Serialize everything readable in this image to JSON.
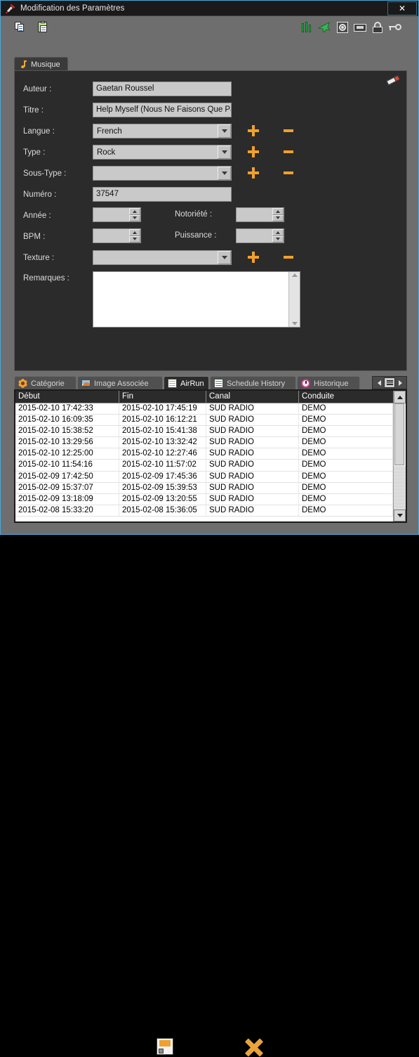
{
  "window": {
    "title": "Modification des Paramètres",
    "title_icon": "wrench-screwdriver-icon",
    "close_label": "✕",
    "accent_orange": "#f0a02e",
    "bg": "#6e6e6e",
    "panel_bg": "#2b2b2b"
  },
  "toolbar": {
    "items": [
      {
        "name": "copy-icon",
        "title": "Copier"
      },
      {
        "name": "paste-icon",
        "title": "Coller"
      },
      {
        "name": "bars-icon",
        "title": "Statistiques"
      },
      {
        "name": "plane-icon",
        "title": "Diffusion"
      },
      {
        "name": "target-icon",
        "title": "Cible"
      },
      {
        "name": "cassette-icon",
        "title": "Cassette"
      },
      {
        "name": "lock-icon",
        "title": "Verrouiller"
      },
      {
        "name": "key-icon",
        "title": "Clé"
      }
    ]
  },
  "top_tab": {
    "label": "Musique",
    "icon": "music-note-icon"
  },
  "form": {
    "eraser_icon": "eraser-icon",
    "fields": {
      "auteur": {
        "label": "Auteur :",
        "value": "Gaetan Roussel",
        "placeholder": ""
      },
      "titre": {
        "label": "Titre :",
        "value": "Help Myself (Nous Ne Faisons Que Pas",
        "placeholder": ""
      },
      "langue": {
        "label": "Langue :",
        "value": "French",
        "placeholder": ""
      },
      "type": {
        "label": "Type :",
        "value": "Rock",
        "placeholder": ""
      },
      "sous_type": {
        "label": "Sous-Type :",
        "value": "",
        "placeholder": ""
      },
      "numero": {
        "label": "Numéro :",
        "value": "37547",
        "placeholder": ""
      },
      "annee": {
        "label": "Année :",
        "value": "",
        "placeholder": ""
      },
      "notoriete": {
        "label": "Notoriété :",
        "value": "",
        "placeholder": ""
      },
      "bpm": {
        "label": "BPM :",
        "value": "",
        "placeholder": ""
      },
      "puissance": {
        "label": "Puissance :",
        "value": "",
        "placeholder": ""
      },
      "texture": {
        "label": "Texture :",
        "value": "",
        "placeholder": ""
      },
      "remarques": {
        "label": "Remarques :",
        "value": "",
        "placeholder": ""
      }
    },
    "add_label": "+",
    "remove_label": "−"
  },
  "bottom_tabs": {
    "items": [
      {
        "label": "Catégorie",
        "icon": "flower-icon",
        "active": false
      },
      {
        "label": "Image Associée",
        "icon": "image-icon",
        "active": false
      },
      {
        "label": "AirRun",
        "icon": "list-orange-icon",
        "active": true
      },
      {
        "label": "Schedule History",
        "icon": "list-green-icon",
        "active": false
      },
      {
        "label": "Historique",
        "icon": "clock-icon",
        "active": false
      }
    ],
    "nav": {
      "prev": "◄",
      "menu": "list-icon",
      "next": "►"
    }
  },
  "table": {
    "columns": [
      "Début",
      "Fin",
      "Canal",
      "Conduite"
    ],
    "rows": [
      [
        "2015-02-10 17:42:33",
        "2015-02-10 17:45:19",
        "SUD RADIO",
        "DEMO"
      ],
      [
        "2015-02-10 16:09:35",
        "2015-02-10 16:12:21",
        "SUD RADIO",
        "DEMO"
      ],
      [
        "2015-02-10 15:38:52",
        "2015-02-10 15:41:38",
        "SUD RADIO",
        "DEMO"
      ],
      [
        "2015-02-10 13:29:56",
        "2015-02-10 13:32:42",
        "SUD RADIO",
        "DEMO"
      ],
      [
        "2015-02-10 12:25:00",
        "2015-02-10 12:27:46",
        "SUD RADIO",
        "DEMO"
      ],
      [
        "2015-02-10 11:54:16",
        "2015-02-10 11:57:02",
        "SUD RADIO",
        "DEMO"
      ],
      [
        "2015-02-09 17:42:50",
        "2015-02-09 17:45:36",
        "SUD RADIO",
        "DEMO"
      ],
      [
        "2015-02-09 15:37:07",
        "2015-02-09 15:39:53",
        "SUD RADIO",
        "DEMO"
      ],
      [
        "2015-02-09 13:18:09",
        "2015-02-09 13:20:55",
        "SUD RADIO",
        "DEMO"
      ],
      [
        "2015-02-08 15:33:20",
        "2015-02-08 15:36:05",
        "SUD RADIO",
        "DEMO"
      ]
    ]
  },
  "actions": {
    "save": {
      "label": "Enregistrer",
      "icon": "floppy-save-icon"
    },
    "cancel": {
      "label": "Annuler",
      "icon": "close-x-icon"
    }
  }
}
